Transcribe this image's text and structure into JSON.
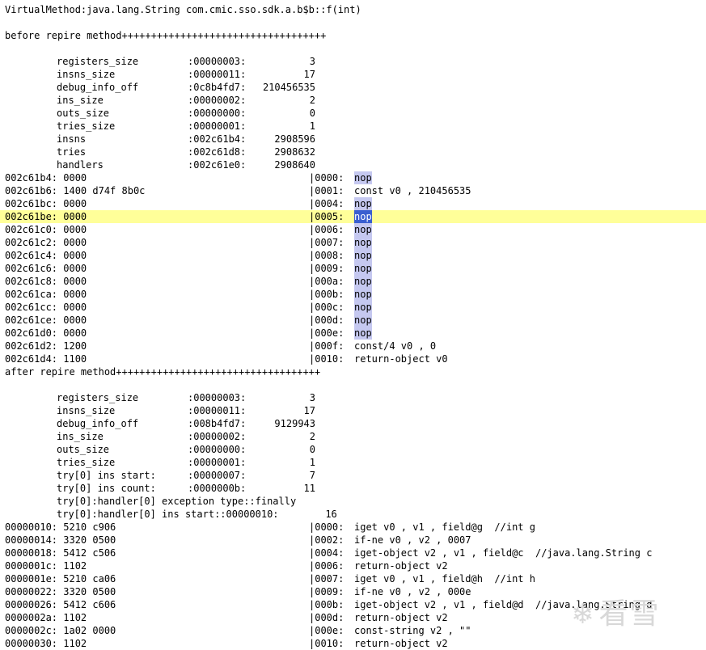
{
  "title": "VirtualMethod:java.lang.String com.cmic.sso.sdk.a.b$b::f(int)",
  "before_header": "before repire method+++++++++++++++++++++++++++++++++++",
  "before_fields": [
    {
      "name": "registers_size",
      "hex": ":00000003:",
      "dec": "3"
    },
    {
      "name": "insns_size",
      "hex": ":00000011:",
      "dec": "17"
    },
    {
      "name": "debug_info_off",
      "hex": ":0c8b4fd7:",
      "dec": "210456535"
    },
    {
      "name": "ins_size",
      "hex": ":00000002:",
      "dec": "2"
    },
    {
      "name": "outs_size",
      "hex": ":00000000:",
      "dec": "0"
    },
    {
      "name": "tries_size",
      "hex": ":00000001:",
      "dec": "1"
    },
    {
      "name": "insns",
      "hex": ":002c61b4:",
      "dec": "2908596"
    },
    {
      "name": "tries",
      "hex": ":002c61d8:",
      "dec": "2908632"
    },
    {
      "name": "handlers",
      "hex": ":002c61e0:",
      "dec": "2908640"
    }
  ],
  "before_code": [
    {
      "addr": "002c61b4: 0000",
      "idx": "|0000:",
      "op": "nop",
      "sel": "light",
      "hl": false
    },
    {
      "addr": "002c61b6: 1400 d74f 8b0c",
      "idx": "|0001:",
      "op": "const v0 , 210456535",
      "sel": "none",
      "hl": false
    },
    {
      "addr": "002c61bc: 0000",
      "idx": "|0004:",
      "op": "nop",
      "sel": "light",
      "hl": false
    },
    {
      "addr": "002c61be: 0000",
      "idx": "|0005:",
      "op": "nop",
      "sel": "strong",
      "hl": true
    },
    {
      "addr": "002c61c0: 0000",
      "idx": "|0006:",
      "op": "nop",
      "sel": "light",
      "hl": false
    },
    {
      "addr": "002c61c2: 0000",
      "idx": "|0007:",
      "op": "nop",
      "sel": "light",
      "hl": false
    },
    {
      "addr": "002c61c4: 0000",
      "idx": "|0008:",
      "op": "nop",
      "sel": "light",
      "hl": false
    },
    {
      "addr": "002c61c6: 0000",
      "idx": "|0009:",
      "op": "nop",
      "sel": "light",
      "hl": false
    },
    {
      "addr": "002c61c8: 0000",
      "idx": "|000a:",
      "op": "nop",
      "sel": "light",
      "hl": false
    },
    {
      "addr": "002c61ca: 0000",
      "idx": "|000b:",
      "op": "nop",
      "sel": "light",
      "hl": false
    },
    {
      "addr": "002c61cc: 0000",
      "idx": "|000c:",
      "op": "nop",
      "sel": "light",
      "hl": false
    },
    {
      "addr": "002c61ce: 0000",
      "idx": "|000d:",
      "op": "nop",
      "sel": "light",
      "hl": false
    },
    {
      "addr": "002c61d0: 0000",
      "idx": "|000e:",
      "op": "nop",
      "sel": "light",
      "hl": false
    },
    {
      "addr": "002c61d2: 1200",
      "idx": "|000f:",
      "op": "const/4 v0 , 0",
      "sel": "none",
      "hl": false
    },
    {
      "addr": "002c61d4: 1100",
      "idx": "|0010:",
      "op": "return-object v0",
      "sel": "none",
      "hl": false
    }
  ],
  "after_header": "after repire method+++++++++++++++++++++++++++++++++++",
  "after_fields": [
    {
      "name": "registers_size",
      "hex": ":00000003:",
      "dec": "3"
    },
    {
      "name": "insns_size",
      "hex": ":00000011:",
      "dec": "17"
    },
    {
      "name": "debug_info_off",
      "hex": ":008b4fd7:",
      "dec": "9129943"
    },
    {
      "name": "ins_size",
      "hex": ":00000002:",
      "dec": "2"
    },
    {
      "name": "outs_size",
      "hex": ":00000000:",
      "dec": "0"
    },
    {
      "name": "tries_size",
      "hex": ":00000001:",
      "dec": "1"
    },
    {
      "name": "try[0] ins start:",
      "hex": ":00000007:",
      "dec": "7"
    },
    {
      "name": "try[0] ins count:",
      "hex": ":0000000b:",
      "dec": "11"
    }
  ],
  "after_handler_lines": [
    "try[0]:handler[0] exception type::finally",
    "try[0]:handler[0] ins start::00000010:        16"
  ],
  "after_code": [
    {
      "addr": "00000010: 5210 c906",
      "idx": "|0000:",
      "op": "iget v0 , v1 , field@g  //int g"
    },
    {
      "addr": "00000014: 3320 0500",
      "idx": "|0002:",
      "op": "if-ne v0 , v2 , 0007"
    },
    {
      "addr": "00000018: 5412 c506",
      "idx": "|0004:",
      "op": "iget-object v2 , v1 , field@c  //java.lang.String c"
    },
    {
      "addr": "0000001c: 1102",
      "idx": "|0006:",
      "op": "return-object v2"
    },
    {
      "addr": "0000001e: 5210 ca06",
      "idx": "|0007:",
      "op": "iget v0 , v1 , field@h  //int h"
    },
    {
      "addr": "00000022: 3320 0500",
      "idx": "|0009:",
      "op": "if-ne v0 , v2 , 000e"
    },
    {
      "addr": "00000026: 5412 c606",
      "idx": "|000b:",
      "op": "iget-object v2 , v1 , field@d  //java.lang.String d"
    },
    {
      "addr": "0000002a: 1102",
      "idx": "|000d:",
      "op": "return-object v2"
    },
    {
      "addr": "0000002c: 1a02 0000",
      "idx": "|000e:",
      "op": "const-string v2 , \"\""
    },
    {
      "addr": "00000030: 1102",
      "idx": "|0010:",
      "op": "return-object v2"
    }
  ],
  "watermark": {
    "icon": "snowflake-icon",
    "text": "看雪"
  },
  "colors": {
    "highlight_row": "#ffff99",
    "selection_light": "#c5c8f0",
    "selection_strong": "#3a5fd0"
  }
}
